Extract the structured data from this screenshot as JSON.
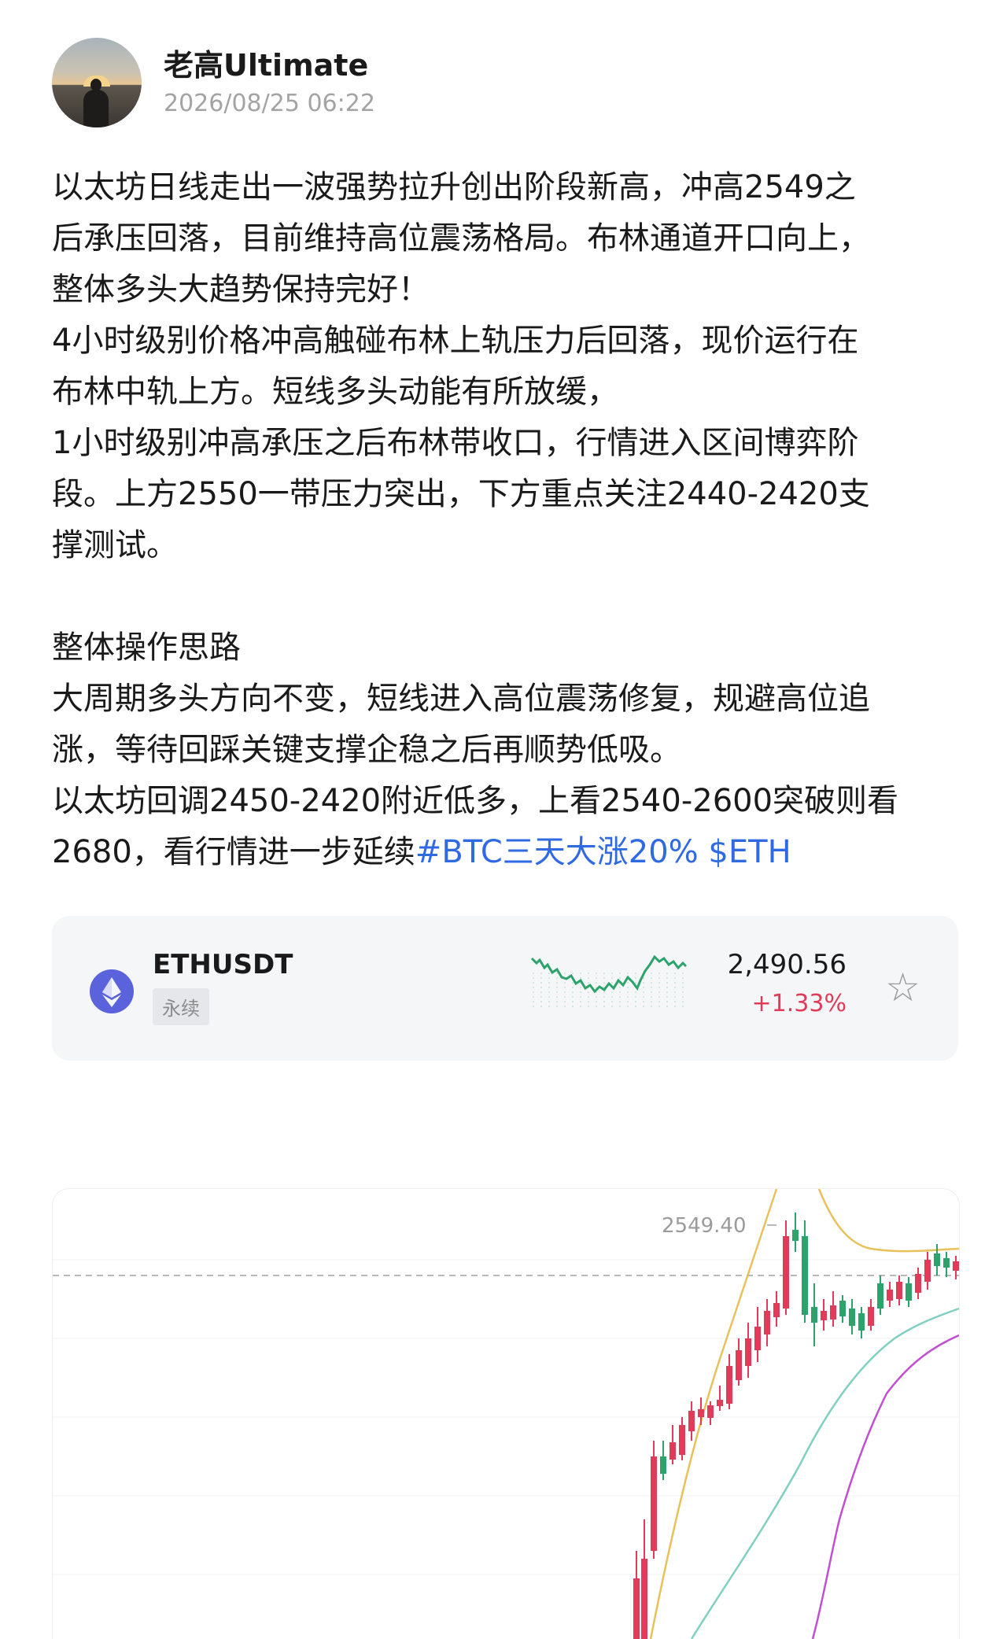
{
  "post": {
    "author": "老高Ultimate",
    "timestamp": "2026/08/25 06:22",
    "lines": [
      "以太坊日线走出一波强势拉升创出阶段新高，冲高2549之",
      "后承压回落，目前维持高位震荡格局。布林通道开口向上，",
      "整体多头大趋势保持完好！",
      "4小时级别价格冲高触碰布林上轨压力后回落，现价运行在",
      "布林中轨上方。短线多头动能有所放缓，",
      "1小时级别冲高承压之后布林带收口，行情进入区间博弈阶",
      "段。上方2550一带压力突出，下方重点关注2440-2420支",
      "撑测试。",
      "",
      "整体操作思路",
      "大周期多头方向不变，短线进入高位震荡修复，规避高位追",
      "涨，等待回踩关键支撑企稳之后再顺势低吸。",
      "以太坊回调2450-2420附近低多，上看2540-2600突破则看"
    ],
    "last_line_text": "2680，看行情进一步延续",
    "tags": [
      "#BTC三天大涨20%",
      "$ETH"
    ]
  },
  "ticker": {
    "icon": "ethereum-icon",
    "symbol": "ETHUSDT",
    "badge": "永续",
    "price": "2,490.56",
    "change": "+1.33%",
    "up_color": "#2ca36b",
    "down_color": "#e03b58",
    "favorite_icon": "star-outline-icon"
  },
  "kline": {
    "high_marker": "2549.40",
    "colors": {
      "up": "#2ca36b",
      "down": "#e03b58",
      "upper_band": "#e8c15a",
      "middle_band": "#7fd0c0",
      "lower_band": "#c24fd1"
    }
  }
}
